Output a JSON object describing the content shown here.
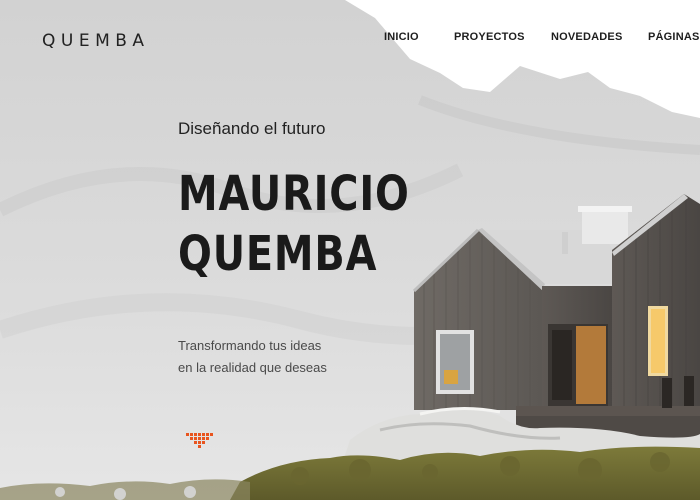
{
  "brand": {
    "logo": "QUEMBA"
  },
  "nav": {
    "items": [
      {
        "label": "INICIO"
      },
      {
        "label": "PROYECTOS"
      },
      {
        "label": "NOVEDADES"
      },
      {
        "label": "PÁGINAS"
      }
    ]
  },
  "hero": {
    "subtitle": "Diseñando el futuro",
    "name_line1": "MAURICIO",
    "name_line2": "QUEMBA",
    "tagline_line1": "Transformando tus ideas",
    "tagline_line2": "en la realidad que deseas",
    "scroll_icon": "chevron-dots-down-icon",
    "accent_color": "#e8541e"
  }
}
